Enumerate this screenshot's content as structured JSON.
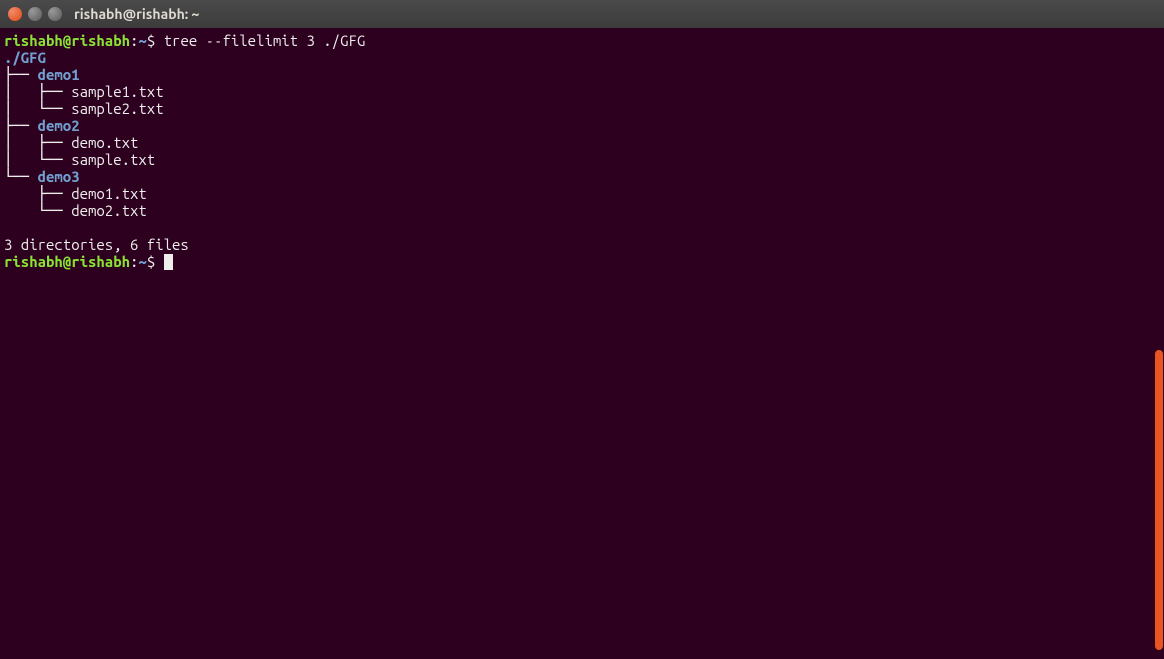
{
  "window": {
    "title": "rishabh@rishabh: ~"
  },
  "prompt1": {
    "user": "rishabh@rishabh",
    "colon": ":",
    "path": "~",
    "dollar": "$ ",
    "command": "tree --filelimit 3 ./GFG"
  },
  "tree": {
    "root": "./GFG",
    "l1": "├── ",
    "l2": "│   ├── ",
    "l3": "│   └── ",
    "l4": "├── ",
    "l5": "│   ├── ",
    "l6": "│   └── ",
    "l7": "└── ",
    "l8": "    ├── ",
    "l9": "    └── ",
    "dir1": "demo1",
    "file1": "sample1.txt",
    "file2": "sample2.txt",
    "dir2": "demo2",
    "file3": "demo.txt",
    "file4": "sample.txt",
    "dir3": "demo3",
    "file5": "demo1.txt",
    "file6": "demo2.txt"
  },
  "summary": "3 directories, 6 files",
  "prompt2": {
    "user": "rishabh@rishabh",
    "colon": ":",
    "path": "~",
    "dollar": "$ "
  }
}
